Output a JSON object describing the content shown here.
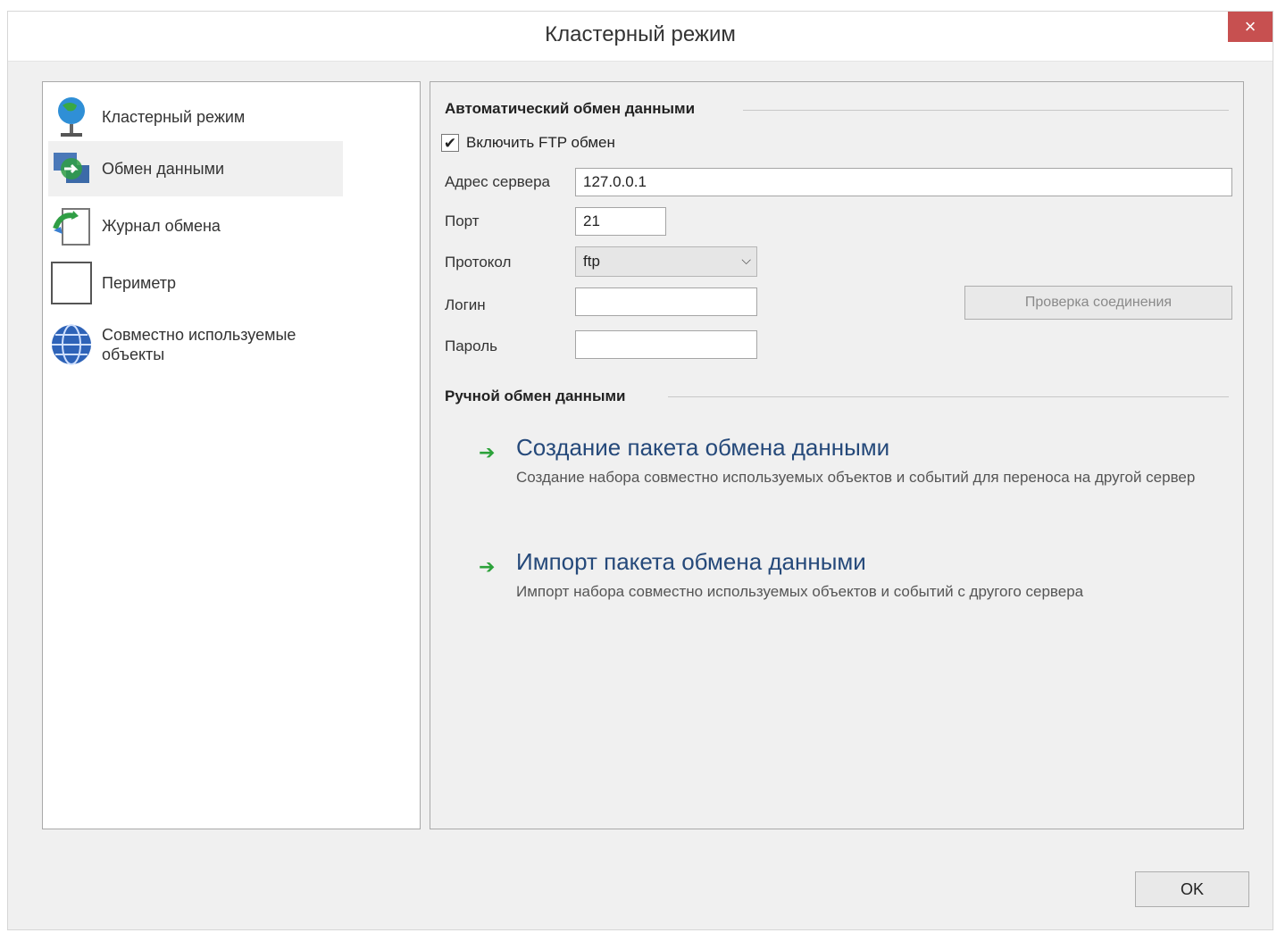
{
  "window": {
    "title": "Кластерный режим",
    "close_label": "×"
  },
  "sidebar": {
    "items": [
      {
        "label": "Кластерный режим",
        "icon": "globe-pin-icon",
        "selected": false
      },
      {
        "label": "Обмен данными",
        "icon": "data-exchange-icon",
        "selected": true
      },
      {
        "label": "Журнал обмена",
        "icon": "exchange-log-icon",
        "selected": false
      },
      {
        "label": "Периметр",
        "icon": "perimeter-icon",
        "selected": false
      },
      {
        "label": "Совместно используемые объекты",
        "icon": "world-icon",
        "selected": false
      }
    ]
  },
  "auto_exchange": {
    "header": "Автоматический обмен данными",
    "ftp_checkbox_label": "Включить FTP обмен",
    "ftp_checked": true,
    "check_mark": "✔",
    "server_label": "Адрес сервера",
    "server_value": "127.0.0.1",
    "port_label": "Порт",
    "port_value": "21",
    "protocol_label": "Протокол",
    "protocol_value": "ftp",
    "login_label": "Логин",
    "login_value": "",
    "password_label": "Пароль",
    "password_value": "",
    "test_button": "Проверка соединения"
  },
  "manual_exchange": {
    "header": "Ручной обмен данными",
    "tasks": [
      {
        "title": "Создание пакета обмена данными",
        "description": "Создание набора совместно используемых объектов и событий для переноса на другой сервер"
      },
      {
        "title": "Импорт пакета обмена данными",
        "description": "Импорт набора совместно используемых объектов и событий с другого сервера"
      }
    ]
  },
  "footer": {
    "ok_label": "OK"
  },
  "colors": {
    "accent_link": "#25497a",
    "arrow_green": "#2ca23a",
    "close_red": "#c75050"
  }
}
